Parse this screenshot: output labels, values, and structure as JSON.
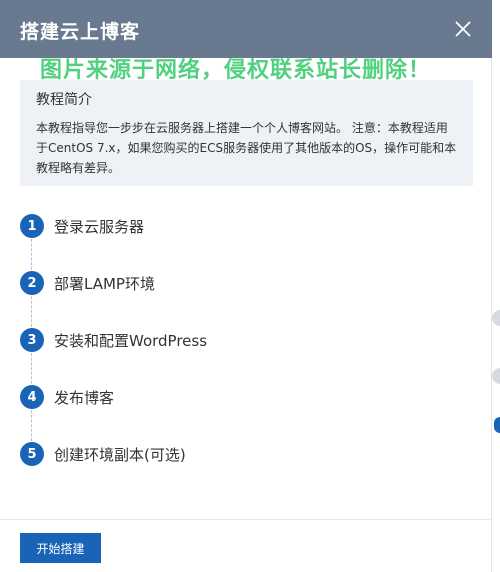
{
  "header": {
    "title": "搭建云上博客",
    "close_icon": "close-icon"
  },
  "watermark": {
    "text": "图片来源于网络，侵权联系站长删除！"
  },
  "intro": {
    "title": "教程简介",
    "body": "本教程指导您一步步在云服务器上搭建一个个人博客网站。 注意：本教程适用于CentOS 7.x，如果您购买的ECS服务器使用了其他版本的OS，操作可能和本教程略有差异。"
  },
  "steps": [
    {
      "number": "1",
      "label": "登录云服务器"
    },
    {
      "number": "2",
      "label": "部署LAMP环境"
    },
    {
      "number": "3",
      "label": "安装和配置WordPress"
    },
    {
      "number": "4",
      "label": "发布博客"
    },
    {
      "number": "5",
      "label": "创建环境副本(可选)"
    }
  ],
  "footer": {
    "start_label": "开始搭建"
  },
  "colors": {
    "header_bg": "#697a90",
    "accent": "#1a64b8",
    "intro_bg": "#eef1f6",
    "watermark": "#33c96b"
  }
}
